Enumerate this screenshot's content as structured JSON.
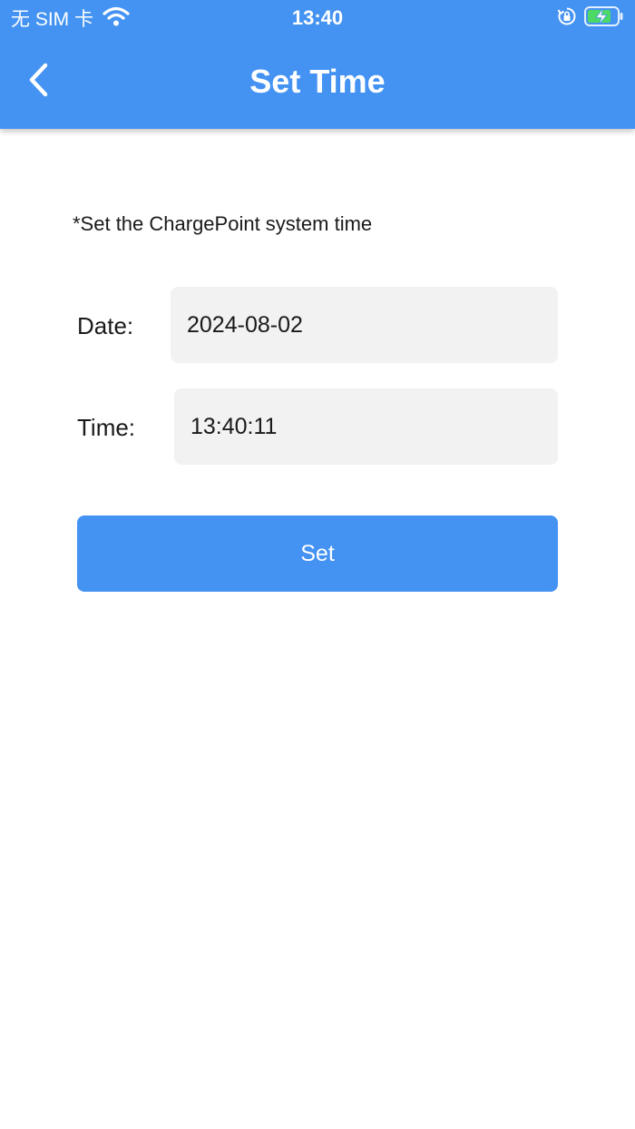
{
  "status_bar": {
    "carrier": "无 SIM 卡",
    "time": "13:40",
    "icons": [
      "wifi-icon",
      "orientation-lock-icon",
      "battery-charging-icon"
    ]
  },
  "nav": {
    "title": "Set Time",
    "back_icon": "chevron-left-icon"
  },
  "form": {
    "hint": "*Set the ChargePoint system time",
    "date_label": "Date:",
    "date_value": "2024-08-02",
    "time_label": "Time:",
    "time_value": "13:40:11",
    "submit_label": "Set"
  },
  "colors": {
    "primary": "#4493f2",
    "field_background": "#f2f2f2",
    "battery_fill": "#4cd964"
  }
}
